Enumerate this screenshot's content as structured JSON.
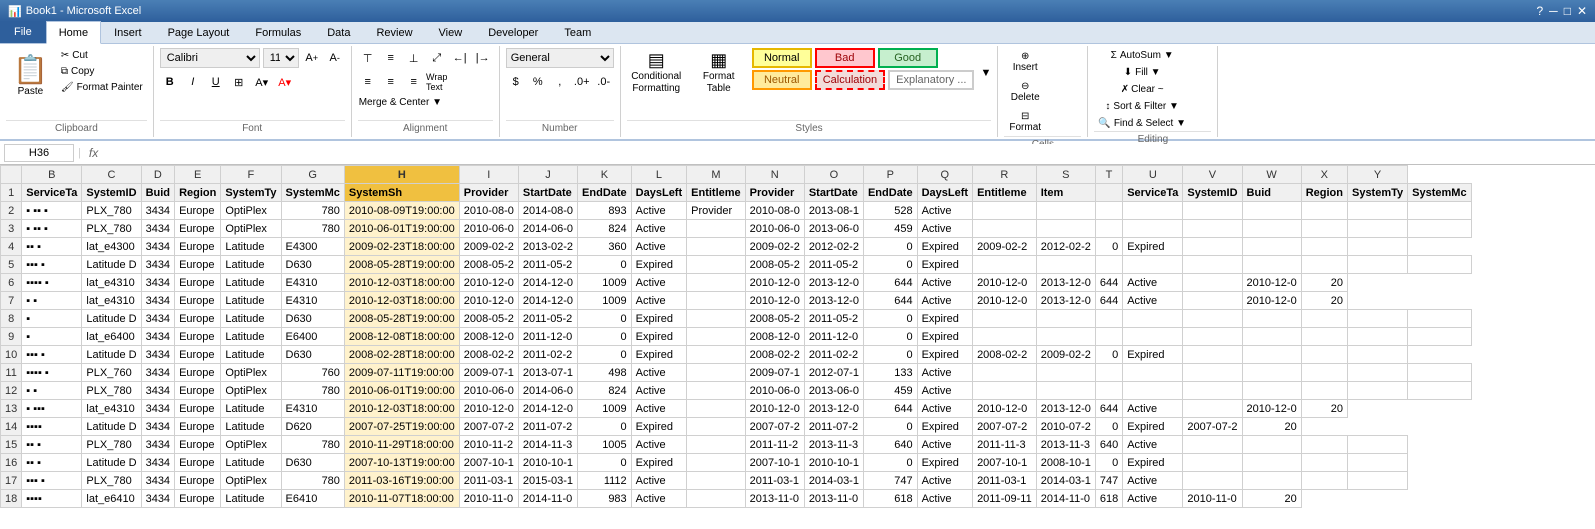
{
  "titlebar": {
    "title": "Microsoft Excel",
    "filename": "Book1 - Microsoft Excel",
    "minimize": "─",
    "restore": "□",
    "close": "✕"
  },
  "tabs": [
    {
      "label": "File",
      "active": false
    },
    {
      "label": "Home",
      "active": true
    },
    {
      "label": "Insert",
      "active": false
    },
    {
      "label": "Page Layout",
      "active": false
    },
    {
      "label": "Formulas",
      "active": false
    },
    {
      "label": "Data",
      "active": false
    },
    {
      "label": "Review",
      "active": false
    },
    {
      "label": "View",
      "active": false
    },
    {
      "label": "Developer",
      "active": false
    },
    {
      "label": "Team",
      "active": false
    }
  ],
  "ribbon": {
    "clipboard": {
      "label": "Clipboard",
      "paste": "Paste",
      "cut": "Cut",
      "copy": "Copy",
      "format_painter": "Format Painter"
    },
    "font": {
      "label": "Font",
      "name": "Calibri",
      "size": "11",
      "bold": "B",
      "italic": "I",
      "underline": "U",
      "grow": "A↑",
      "shrink": "A↓"
    },
    "alignment": {
      "label": "Alignment",
      "wrap_text": "Wrap Text",
      "merge_center": "Merge & Center ▼"
    },
    "number": {
      "label": "Number",
      "format": "General"
    },
    "styles": {
      "label": "Styles",
      "conditional_formatting": "Conditional Formatting",
      "format_table": "Format Table",
      "normal": "Normal",
      "bad": "Bad",
      "good": "Good",
      "neutral": "Neutral",
      "calculation": "Calculation",
      "explanatory": "Explanatory ..."
    },
    "cells": {
      "label": "Cells",
      "insert": "Insert",
      "delete": "Delete",
      "format": "Format"
    },
    "editing": {
      "label": "Editing",
      "autosum": "AutoSum ▼",
      "fill": "Fill ▼",
      "clear": "Clear ~",
      "sort_filter": "Sort & Filter ▼",
      "find_select": "Find & Select ▼"
    }
  },
  "formula_bar": {
    "cell_ref": "H36",
    "fx": "fx",
    "formula": ""
  },
  "spreadsheet": {
    "selected_col": "H",
    "selected_cell": "H36",
    "columns": [
      "",
      "B",
      "C",
      "D",
      "E",
      "F",
      "G",
      "H",
      "I",
      "J",
      "K",
      "L",
      "M",
      "N",
      "O",
      "P",
      "Q",
      "R",
      "S",
      "T",
      "U",
      "V",
      "W",
      "X",
      "Y"
    ],
    "rows": [
      {
        "num": "1",
        "cells": [
          "ServiceTa",
          "SystemID",
          "Buid",
          "Region",
          "SystemTy",
          "SystemMc",
          "SystemSh",
          "Provider",
          "StartDate",
          "EndDate",
          "DaysLeft",
          "Entitleme",
          "Provider",
          "StartDate",
          "EndDate",
          "DaysLeft",
          "Entitleme",
          "Item",
          "",
          "ServiceTa",
          "SystemID",
          "Buid",
          "Region",
          "SystemTy",
          "SystemMc"
        ]
      },
      {
        "num": "2",
        "cells": [
          "▪ ▪▪ ▪",
          "PLX_780",
          "3434",
          "Europe",
          "OptiPlex",
          "780",
          "2010-08-09T19:00:00",
          "2010-08-0",
          "2014-08-0",
          "893",
          "Active",
          "Provider",
          "2010-08-0",
          "2013-08-1",
          "528",
          "Active",
          "",
          "",
          "",
          "",
          "",
          "",
          "",
          "",
          ""
        ]
      },
      {
        "num": "3",
        "cells": [
          "▪ ▪▪ ▪",
          "PLX_780",
          "3434",
          "Europe",
          "OptiPlex",
          "780",
          "2010-06-01T19:00:00",
          "2010-06-0",
          "2014-06-0",
          "824",
          "Active",
          "",
          "2010-06-0",
          "2013-06-0",
          "459",
          "Active",
          "",
          "",
          "",
          "",
          "",
          "",
          "",
          "",
          ""
        ]
      },
      {
        "num": "4",
        "cells": [
          "▪▪ ▪",
          "lat_e4300",
          "3434",
          "Europe",
          "Latitude",
          "E4300",
          "2009-02-23T18:00:00",
          "2009-02-2",
          "2013-02-2",
          "360",
          "Active",
          "",
          "2009-02-2",
          "2012-02-2",
          "0",
          "Expired",
          "2009-02-2",
          "2012-02-2",
          "0",
          "Expired",
          "",
          "",
          "",
          ""
        ]
      },
      {
        "num": "5",
        "cells": [
          "▪▪▪ ▪",
          "Latitude D",
          "3434",
          "Europe",
          "Latitude",
          "D630",
          "2008-05-28T19:00:00",
          "2008-05-2",
          "2011-05-2",
          "0",
          "Expired",
          "",
          "2008-05-2",
          "2011-05-2",
          "0",
          "Expired",
          "",
          "",
          "",
          "",
          "",
          "",
          "",
          "",
          ""
        ]
      },
      {
        "num": "6",
        "cells": [
          "▪▪▪▪ ▪",
          "lat_e4310",
          "3434",
          "Europe",
          "Latitude",
          "E4310",
          "2010-12-03T18:00:00",
          "2010-12-0",
          "2014-12-0",
          "1009",
          "Active",
          "",
          "2010-12-0",
          "2013-12-0",
          "644",
          "Active",
          "2010-12-0",
          "2013-12-0",
          "644",
          "Active",
          "",
          "2010-12-0",
          "20"
        ]
      },
      {
        "num": "7",
        "cells": [
          "▪ ▪",
          "lat_e4310",
          "3434",
          "Europe",
          "Latitude",
          "E4310",
          "2010-12-03T18:00:00",
          "2010-12-0",
          "2014-12-0",
          "1009",
          "Active",
          "",
          "2010-12-0",
          "2013-12-0",
          "644",
          "Active",
          "2010-12-0",
          "2013-12-0",
          "644",
          "Active",
          "",
          "2010-12-0",
          "20"
        ]
      },
      {
        "num": "8",
        "cells": [
          "▪",
          "Latitude D",
          "3434",
          "Europe",
          "Latitude",
          "D630",
          "2008-05-28T19:00:00",
          "2008-05-2",
          "2011-05-2",
          "0",
          "Expired",
          "",
          "2008-05-2",
          "2011-05-2",
          "0",
          "Expired",
          "",
          "",
          "",
          "",
          "",
          "",
          "",
          "",
          ""
        ]
      },
      {
        "num": "9",
        "cells": [
          "▪",
          "lat_e6400",
          "3434",
          "Europe",
          "Latitude",
          "E6400",
          "2008-12-08T18:00:00",
          "2008-12-0",
          "2011-12-0",
          "0",
          "Expired",
          "",
          "2008-12-0",
          "2011-12-0",
          "0",
          "Expired",
          "",
          "",
          "",
          "",
          "",
          "",
          "",
          "",
          ""
        ]
      },
      {
        "num": "10",
        "cells": [
          "▪▪▪ ▪",
          "Latitude D",
          "3434",
          "Europe",
          "Latitude",
          "D630",
          "2008-02-28T18:00:00",
          "2008-02-2",
          "2011-02-2",
          "0",
          "Expired",
          "",
          "2008-02-2",
          "2011-02-2",
          "0",
          "Expired",
          "2008-02-2",
          "2009-02-2",
          "0",
          "Expired",
          "",
          "",
          "",
          ""
        ]
      },
      {
        "num": "11",
        "cells": [
          "▪▪▪▪ ▪",
          "PLX_760",
          "3434",
          "Europe",
          "OptiPlex",
          "760",
          "2009-07-11T19:00:00",
          "2009-07-1",
          "2013-07-1",
          "498",
          "Active",
          "",
          "2009-07-1",
          "2012-07-1",
          "133",
          "Active",
          "",
          "",
          "",
          "",
          "",
          "",
          "",
          "",
          ""
        ]
      },
      {
        "num": "12",
        "cells": [
          "▪ ▪",
          "PLX_780",
          "3434",
          "Europe",
          "OptiPlex",
          "780",
          "2010-06-01T19:00:00",
          "2010-06-0",
          "2014-06-0",
          "824",
          "Active",
          "",
          "2010-06-0",
          "2013-06-0",
          "459",
          "Active",
          "",
          "",
          "",
          "",
          "",
          "",
          "",
          "",
          ""
        ]
      },
      {
        "num": "13",
        "cells": [
          "▪ ▪▪▪",
          "lat_e4310",
          "3434",
          "Europe",
          "Latitude",
          "E4310",
          "2010-12-03T18:00:00",
          "2010-12-0",
          "2014-12-0",
          "1009",
          "Active",
          "",
          "2010-12-0",
          "2013-12-0",
          "644",
          "Active",
          "2010-12-0",
          "2013-12-0",
          "644",
          "Active",
          "",
          "2010-12-0",
          "20"
        ]
      },
      {
        "num": "14",
        "cells": [
          "▪▪▪▪",
          "Latitude D",
          "3434",
          "Europe",
          "Latitude",
          "D620",
          "2007-07-25T19:00:00",
          "2007-07-2",
          "2011-07-2",
          "0",
          "Expired",
          "",
          "2007-07-2",
          "2011-07-2",
          "0",
          "Expired",
          "2007-07-2",
          "2010-07-2",
          "0",
          "Expired",
          "2007-07-2",
          "20"
        ]
      },
      {
        "num": "15",
        "cells": [
          "▪▪ ▪",
          "PLX_780",
          "3434",
          "Europe",
          "OptiPlex",
          "780",
          "2010-11-29T18:00:00",
          "2010-11-2",
          "2014-11-3",
          "1005",
          "Active",
          "",
          "2011-11-2",
          "2013-11-3",
          "640",
          "Active",
          "2011-11-3",
          "2013-11-3",
          "640",
          "Active",
          "",
          "",
          "",
          ""
        ]
      },
      {
        "num": "16",
        "cells": [
          "▪▪ ▪",
          "Latitude D",
          "3434",
          "Europe",
          "Latitude",
          "D630",
          "2007-10-13T19:00:00",
          "2007-10-1",
          "2010-10-1",
          "0",
          "Expired",
          "",
          "2007-10-1",
          "2010-10-1",
          "0",
          "Expired",
          "2007-10-1",
          "2008-10-1",
          "0",
          "Expired",
          "",
          "",
          "",
          ""
        ]
      },
      {
        "num": "17",
        "cells": [
          "▪▪▪ ▪",
          "PLX_780",
          "3434",
          "Europe",
          "OptiPlex",
          "780",
          "2011-03-16T19:00:00",
          "2011-03-1",
          "2015-03-1",
          "1112",
          "Active",
          "",
          "2011-03-1",
          "2014-03-1",
          "747",
          "Active",
          "2011-03-1",
          "2014-03-1",
          "747",
          "Active",
          "",
          "",
          "",
          ""
        ]
      },
      {
        "num": "18",
        "cells": [
          "▪▪▪▪",
          "lat_e6410",
          "3434",
          "Europe",
          "Latitude",
          "E6410",
          "2010-11-07T18:00:00",
          "2010-11-0",
          "2014-11-0",
          "983",
          "Active",
          "",
          "2013-11-0",
          "2013-11-0",
          "618",
          "Active",
          "2011-09-11",
          "2014-11-0",
          "618",
          "Active",
          "2010-11-0",
          "20"
        ]
      }
    ]
  }
}
